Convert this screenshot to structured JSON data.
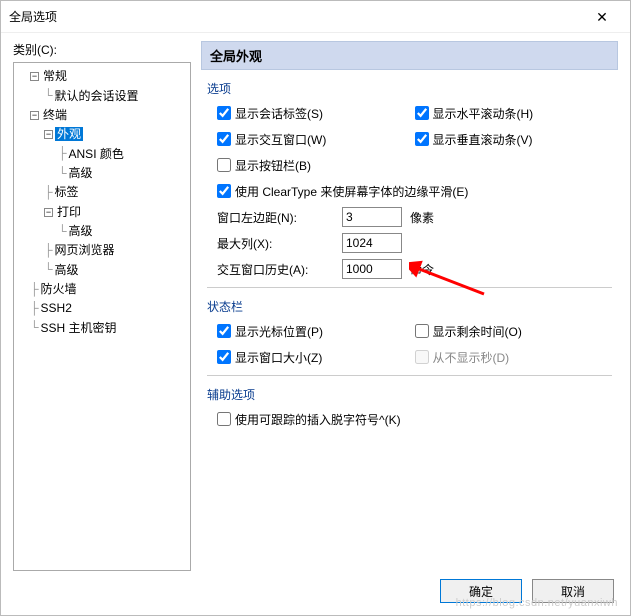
{
  "window": {
    "title": "全局选项"
  },
  "left": {
    "category_label": "类别(C):",
    "tree": {
      "general": "常规",
      "default_session": "默认的会话设置",
      "terminal": "终端",
      "appearance": "外观",
      "ansi_color": "ANSI 颜色",
      "advanced1": "高级",
      "tabs": "标签",
      "print": "打印",
      "advanced2": "高级",
      "web_browser": "网页浏览器",
      "advanced3": "高级",
      "firewall": "防火墙",
      "ssh2": "SSH2",
      "ssh_hostkeys": "SSH 主机密钥"
    }
  },
  "panel": {
    "header": "全局外观",
    "options": {
      "title": "选项",
      "show_session_tabs": "显示会话标签(S)",
      "show_hscroll": "显示水平滚动条(H)",
      "show_interactive": "显示交互窗口(W)",
      "show_vscroll": "显示垂直滚动条(V)",
      "show_button_bar": "显示按钮栏(B)",
      "use_cleartype": "使用 ClearType 来使屏幕字体的边缘平滑(E)",
      "left_margin_label": "窗口左边距(N):",
      "left_margin_value": "3",
      "left_margin_unit": "像素",
      "max_cols_label": "最大列(X):",
      "max_cols_value": "1024",
      "history_label": "交互窗口历史(A):",
      "history_value": "1000",
      "history_unit": "命令"
    },
    "statusbar": {
      "title": "状态栏",
      "show_cursor": "显示光标位置(P)",
      "show_remaining": "显示剩余时间(O)",
      "show_winsize": "显示窗口大小(Z)",
      "never_show_sec": "从不显示秒(D)"
    },
    "aux": {
      "title": "辅助选项",
      "use_caret": "使用可跟踪的插入脱字符号^(K)"
    }
  },
  "footer": {
    "ok": "确定",
    "cancel": "取消"
  },
  "watermark": "https://blog.csdn.net/yuanxiwh"
}
